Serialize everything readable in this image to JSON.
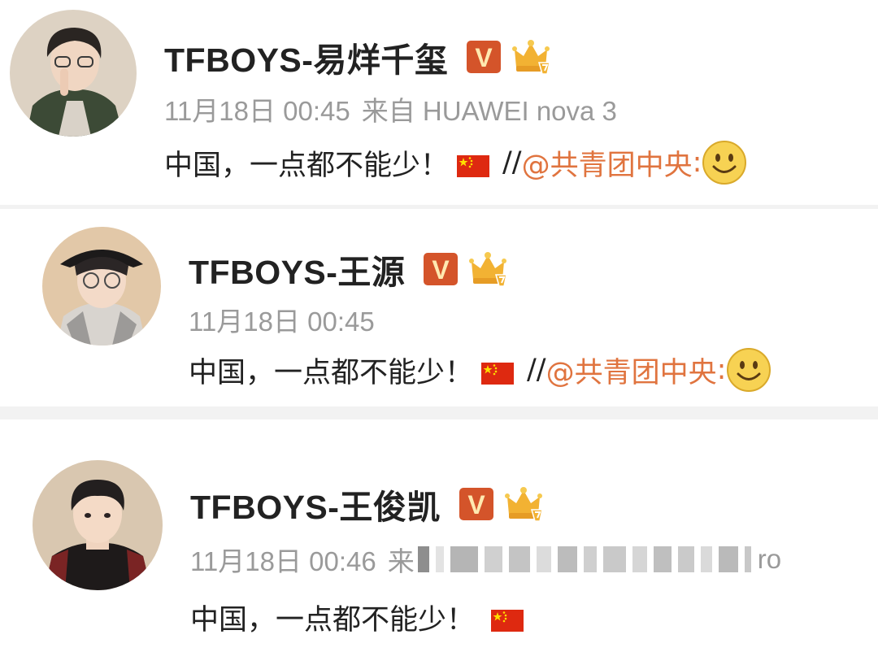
{
  "colors": {
    "username": "#222222",
    "meta": "#9a9a9a",
    "mention": "#e0743f",
    "vbadge": "#d4542a",
    "crown": "#f2b233",
    "separator": "#f2f2f2"
  },
  "posts": [
    {
      "username": "TFBOYS-易烊千玺",
      "badge_label": "V",
      "time": "11月18日 00:45",
      "source": "来自 HUAWEI nova 3",
      "text": "中国，一点都不能少！",
      "slash": "//",
      "mention": "@共青团中央",
      "mention_suffix": ":",
      "icons": [
        "verified-v-icon",
        "crown-icon",
        "china-flag-icon",
        "smile-emoji-icon"
      ]
    },
    {
      "username": "TFBOYS-王源",
      "badge_label": "V",
      "time": "11月18日 00:45",
      "text": "中国，一点都不能少！",
      "slash": "//",
      "mention": "@共青团中央",
      "mention_suffix": ":",
      "icons": [
        "verified-v-icon",
        "crown-icon",
        "china-flag-icon",
        "smile-emoji-icon"
      ]
    },
    {
      "username": "TFBOYS-王俊凯",
      "badge_label": "V",
      "time": "11月18日 00:46",
      "source_prefix": "来",
      "source_suffix": "ro",
      "text": "中国，一点都不能少！",
      "icons": [
        "verified-v-icon",
        "crown-icon",
        "china-flag-icon"
      ]
    }
  ]
}
